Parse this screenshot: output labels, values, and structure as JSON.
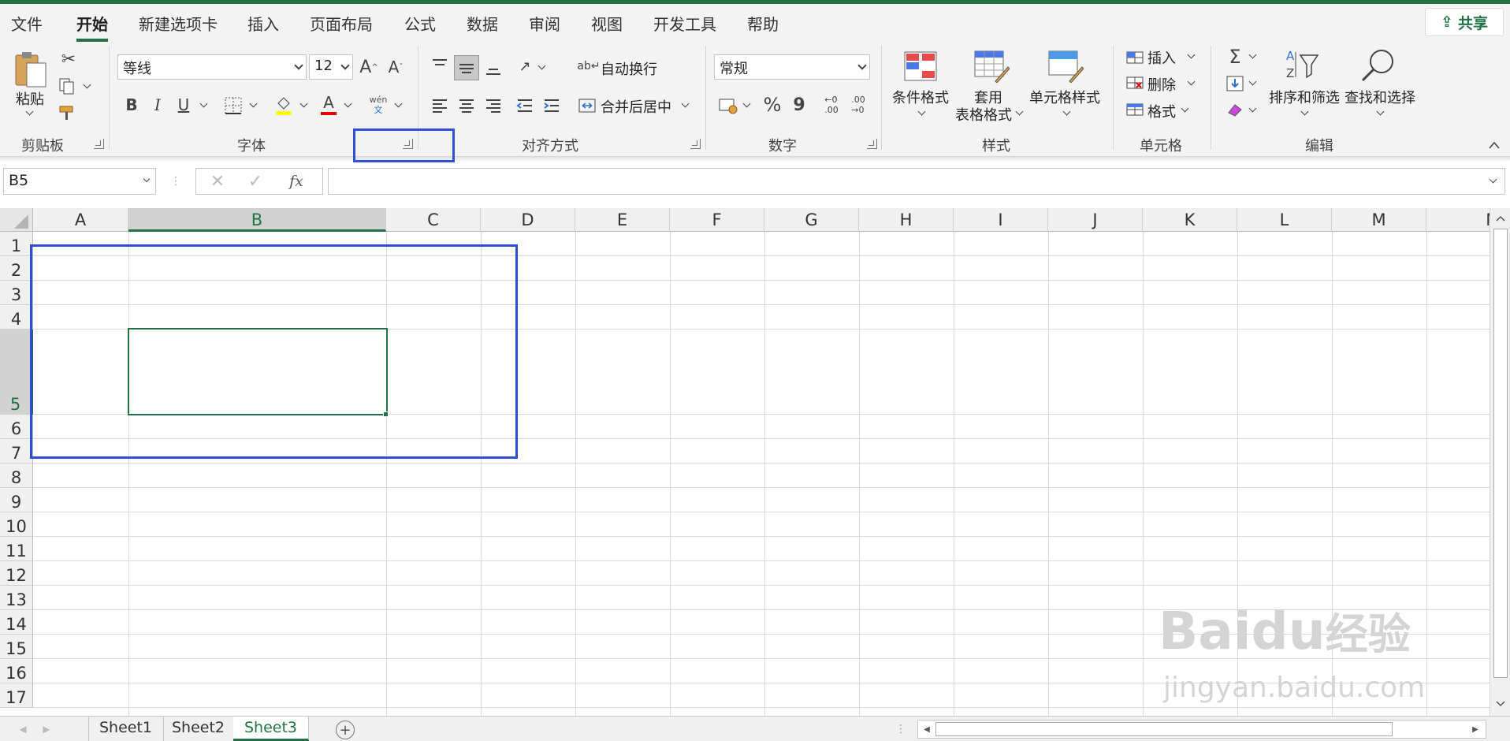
{
  "tabs": [
    "文件",
    "开始",
    "新建选项卡",
    "插入",
    "页面布局",
    "公式",
    "数据",
    "审阅",
    "视图",
    "开发工具",
    "帮助"
  ],
  "share_label": "共享",
  "clipboard": {
    "paste": "粘贴",
    "group": "剪贴板"
  },
  "font": {
    "name": "等线",
    "size": "12",
    "group": "字体",
    "bold": "B",
    "italic": "I",
    "underline": "U",
    "grow": "A",
    "shrink": "A",
    "color_a": "A",
    "phonetic_top": "wén",
    "phonetic_bot": "文"
  },
  "align": {
    "wrap": "自动换行",
    "merge": "合并后居中",
    "group": "对齐方式"
  },
  "number": {
    "format": "常规",
    "group": "数字",
    "percent": "%",
    "comma": "9",
    "inc": "←0\n.00",
    "dec": ".00\n→0"
  },
  "styles": {
    "cond": "条件格式",
    "table1": "套用",
    "table2": "表格格式",
    "cell": "单元格样式",
    "group": "样式"
  },
  "cells": {
    "insert": "插入",
    "delete": "删除",
    "format": "格式",
    "group": "单元格"
  },
  "editing": {
    "sort": "排序和筛选",
    "find": "查找和选择",
    "group": "编辑",
    "sigma": "Σ"
  },
  "namebox": "B5",
  "fx": "fx",
  "columns": [
    "A",
    "B",
    "C",
    "D",
    "E",
    "F",
    "G",
    "H",
    "I",
    "J",
    "K",
    "L",
    "M",
    "N"
  ],
  "rows": [
    "1",
    "2",
    "3",
    "4",
    "5",
    "6",
    "7",
    "8",
    "9",
    "10",
    "11",
    "12",
    "13",
    "14",
    "15",
    "16",
    "17"
  ],
  "sheets": [
    "Sheet1",
    "Sheet2",
    "Sheet3"
  ],
  "active_sheet": "Sheet3",
  "watermark": {
    "brand": "Bai",
    "paw": "du",
    "cn": "经验",
    "url": "jingyan.baidu.com"
  },
  "colors": {
    "accent": "#217346",
    "annotation": "#2e4fd6"
  }
}
